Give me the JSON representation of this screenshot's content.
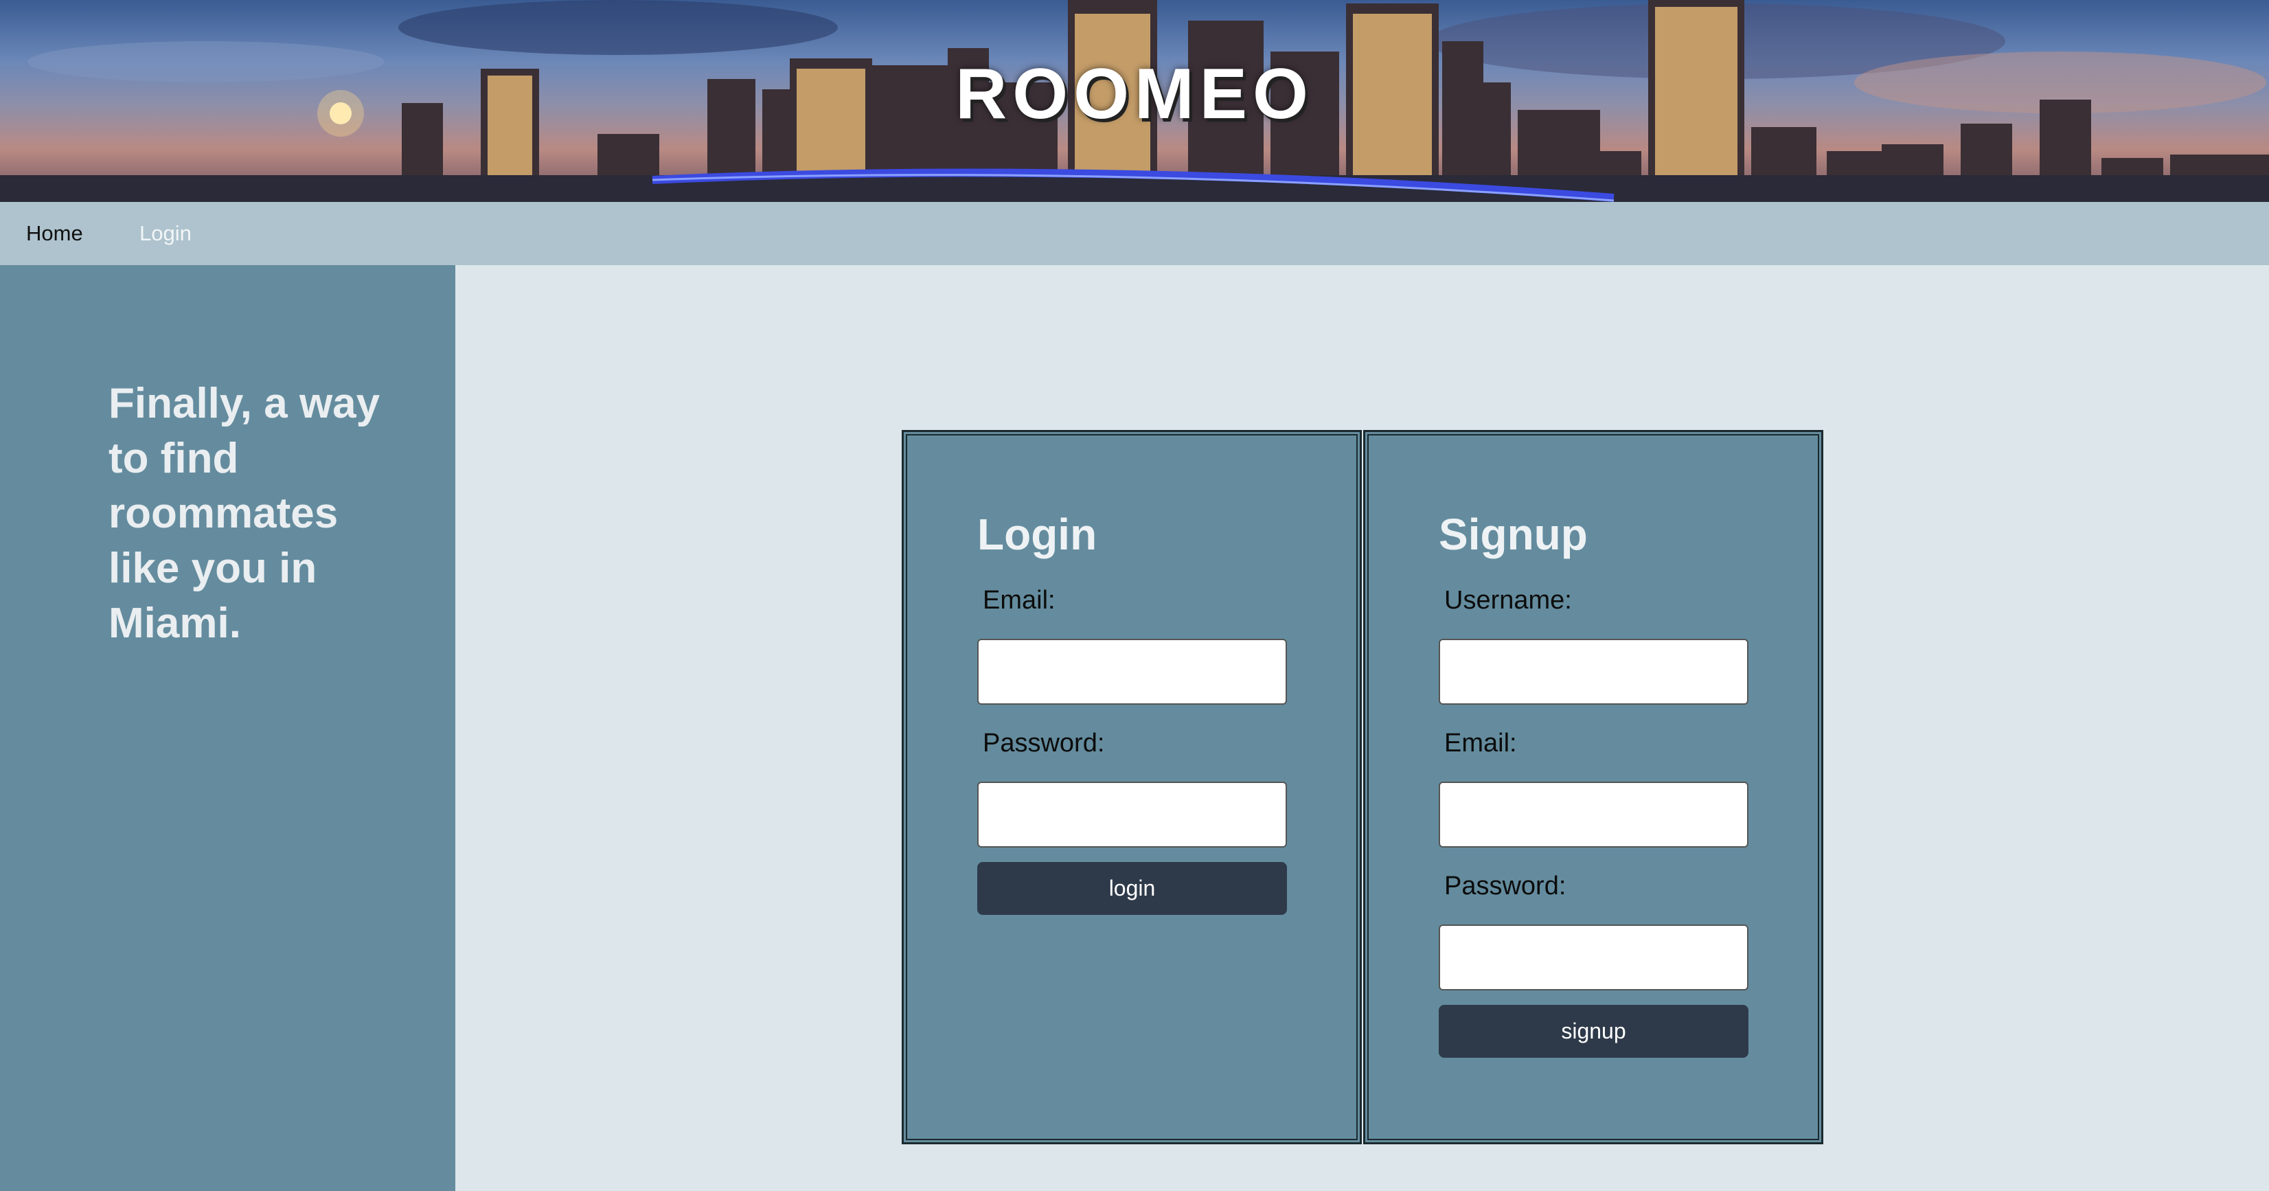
{
  "header": {
    "title": "ROOMEO"
  },
  "nav": {
    "home": "Home",
    "login": "Login"
  },
  "sidebar": {
    "tagline": "Finally, a way to find roommates like you in Miami."
  },
  "login_form": {
    "heading": "Login",
    "email_label": "Email:",
    "password_label": "Password:",
    "button_label": "login"
  },
  "signup_form": {
    "heading": "Signup",
    "username_label": "Username:",
    "email_label": "Email:",
    "password_label": "Password:",
    "button_label": "signup"
  },
  "colors": {
    "nav_bg": "#aec3cd",
    "sidebar_bg": "#648c9e",
    "panel_bg": "#648c9e",
    "page_bg": "#dce6eb",
    "button_bg": "#2e3a4a"
  }
}
